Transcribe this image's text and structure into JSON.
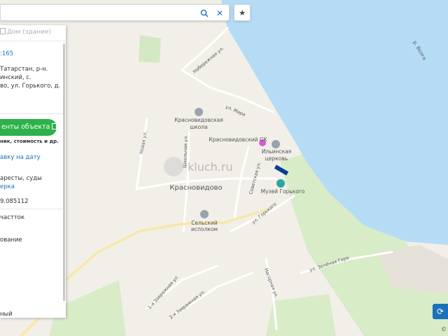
{
  "search": {
    "value": "",
    "placeholder": ""
  },
  "panel": {
    "tab_label": "Дом (здание)",
    "cadastral_fragment": ":165",
    "address_lines": [
      "Татарстан, р-н.",
      "инский, с.",
      "во, ул. Горького, д."
    ],
    "report_button_label": "енты объекта",
    "report_subtitle": "ник, стоимость и др.",
    "date_link": "авку на дату",
    "arrests_label": "аресты, суды",
    "check_link": "ерка",
    "value_fragment": "9.085112",
    "land_label": "частток",
    "usage_label": "ование",
    "bottom_label": "ный"
  },
  "map": {
    "village": "Красновидово",
    "school": "Красновидовская школа",
    "club": "Красновидовский СК",
    "church": "Ильинская церковь",
    "museum": "Музей Горького",
    "rural_committee": "Сельский исполком",
    "river": "р. Волга",
    "watermark": "kluch.ru",
    "streets": {
      "naberezhnaya": "Набережная ул.",
      "mira": "ул. Мира",
      "novaya": "Новая ул.",
      "shkolnaya": "Школьная ул.",
      "sovetskaya": "Советская ул.",
      "gorkogo": "ул. Горького",
      "zelenaya_gora": "ул. Зелёная Гора",
      "nagornaya": "Нагорная ул.",
      "zavrazhnaya1": "1-я Завражная ул.",
      "zavrazhnaya2": "2-я Завражная ул."
    },
    "colors": {
      "water": "#b6dcf5",
      "land": "#f2efe9",
      "green": "#cfe8c0",
      "accent": "#1a73b8",
      "button": "#2db14a"
    }
  },
  "icons": [
    "search-icon",
    "close-icon",
    "star-icon",
    "building-icon",
    "document-icon",
    "refresh-icon"
  ],
  "copyright": "©"
}
